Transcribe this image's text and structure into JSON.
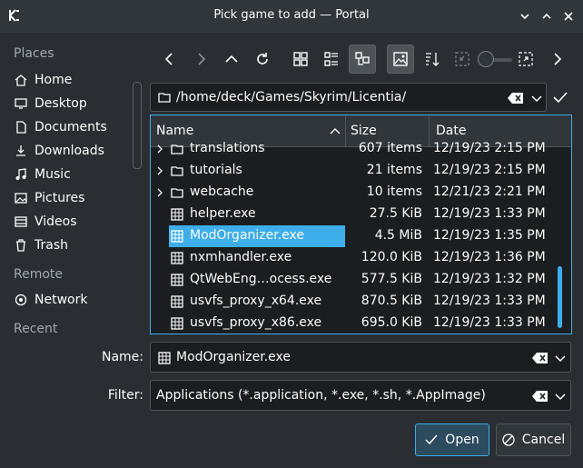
{
  "window": {
    "title": "Pick game to add — Portal"
  },
  "places": {
    "sections": [
      {
        "label": "Places",
        "items": [
          {
            "label": "Home",
            "icon": "home-icon"
          },
          {
            "label": "Desktop",
            "icon": "desktop-icon"
          },
          {
            "label": "Documents",
            "icon": "documents-icon"
          },
          {
            "label": "Downloads",
            "icon": "downloads-icon"
          },
          {
            "label": "Music",
            "icon": "music-icon"
          },
          {
            "label": "Pictures",
            "icon": "pictures-icon"
          },
          {
            "label": "Videos",
            "icon": "videos-icon"
          },
          {
            "label": "Trash",
            "icon": "trash-icon"
          }
        ]
      },
      {
        "label": "Remote",
        "items": [
          {
            "label": "Network",
            "icon": "network-icon"
          }
        ]
      },
      {
        "label": "Recent",
        "items": []
      }
    ]
  },
  "path": {
    "value": "/home/deck/Games/Skyrim/Licentia/"
  },
  "filelist": {
    "columns": [
      "Name",
      "Size",
      "Date"
    ],
    "rows": [
      {
        "name": "translations",
        "size": "607 items",
        "date": "12/19/23 2:15 PM",
        "type": "folder"
      },
      {
        "name": "tutorials",
        "size": "21 items",
        "date": "12/19/23 2:15 PM",
        "type": "folder"
      },
      {
        "name": "webcache",
        "size": "10 items",
        "date": "12/21/23 2:21 PM",
        "type": "folder"
      },
      {
        "name": "helper.exe",
        "size": "27.5 KiB",
        "date": "12/19/23 1:33 PM",
        "type": "exe"
      },
      {
        "name": "ModOrganizer.exe",
        "size": "4.5 MiB",
        "date": "12/19/23 1:35 PM",
        "type": "exe",
        "selected": true
      },
      {
        "name": "nxmhandler.exe",
        "size": "120.0 KiB",
        "date": "12/19/23 1:36 PM",
        "type": "exe"
      },
      {
        "name": "QtWebEng…ocess.exe",
        "size": "577.5 KiB",
        "date": "12/19/23 1:32 PM",
        "type": "exe"
      },
      {
        "name": "usvfs_proxy_x64.exe",
        "size": "870.5 KiB",
        "date": "12/19/23 1:33 PM",
        "type": "exe"
      },
      {
        "name": "usvfs_proxy_x86.exe",
        "size": "695.0 KiB",
        "date": "12/19/23 1:33 PM",
        "type": "exe"
      }
    ]
  },
  "name_field": {
    "label": "Name:",
    "value": "ModOrganizer.exe"
  },
  "filter_field": {
    "label": "Filter:",
    "value": "Applications (*.application, *.exe, *.sh, *.AppImage)"
  },
  "buttons": {
    "open": "Open",
    "cancel": "Cancel"
  },
  "colors": {
    "accent": "#3daee9",
    "background": "#2a2e32",
    "field": "#1b1e20"
  }
}
